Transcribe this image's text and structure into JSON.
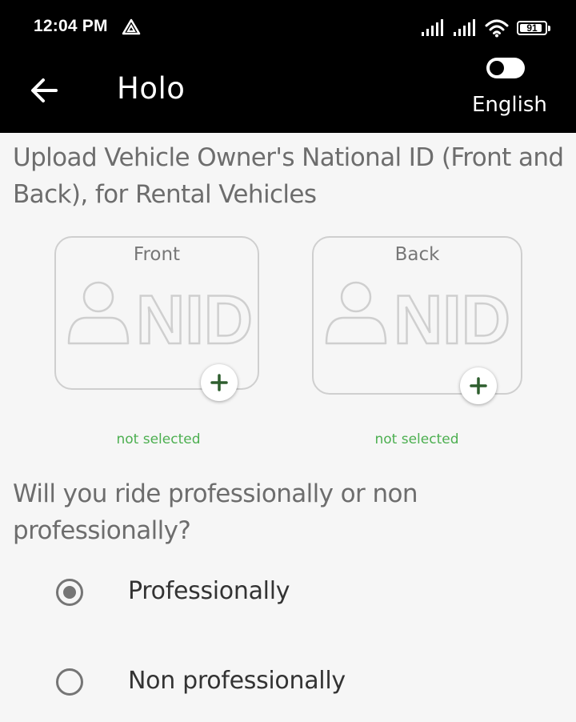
{
  "status_bar": {
    "time": "12:04 PM",
    "app_icon": "delta-icon",
    "signal_icons": [
      "signal-icon",
      "signal-icon"
    ],
    "wifi_icon": "wifi-icon",
    "battery_level": "91"
  },
  "app_bar": {
    "back_icon": "arrow-left-icon",
    "title": "Holo",
    "language_toggle_on": false,
    "language_label": "English"
  },
  "upload_section": {
    "title": "Upload Vehicle Owner's National ID (Front and Back), for Rental Vehicles",
    "cards": [
      {
        "label": "Front",
        "graphic_text": "NID",
        "status": "not selected"
      },
      {
        "label": "Back",
        "graphic_text": "NID",
        "status": "not selected"
      }
    ],
    "add_icon": "plus-icon",
    "status_color": "#4caf50",
    "add_icon_color": "#2e5e2e"
  },
  "ride_question": {
    "title": "Will you ride professionally or non professionally?",
    "options": [
      {
        "label": "Professionally",
        "selected": true
      },
      {
        "label": "Non professionally",
        "selected": false
      }
    ]
  }
}
